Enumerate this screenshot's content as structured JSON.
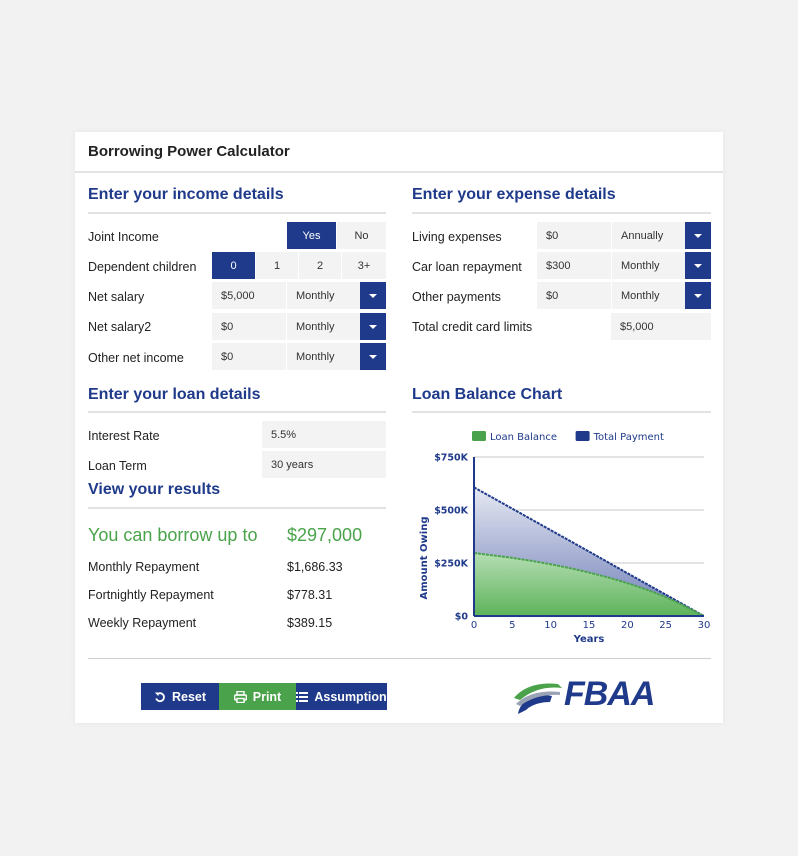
{
  "app": {
    "title": "Borrowing Power Calculator"
  },
  "income": {
    "title": "Enter your income details",
    "joint_income": {
      "label": "Joint Income",
      "options": [
        "Yes",
        "No"
      ],
      "selected": "Yes"
    },
    "dependent_children": {
      "label": "Dependent children",
      "options": [
        "0",
        "1",
        "2",
        "3+"
      ],
      "selected": "0"
    },
    "rows": [
      {
        "label": "Net salary",
        "value": "$5,000",
        "frequency": "Monthly"
      },
      {
        "label": "Net salary2",
        "value": "$0",
        "frequency": "Monthly"
      },
      {
        "label": "Other net income",
        "value": "$0",
        "frequency": "Monthly"
      }
    ]
  },
  "expenses": {
    "title": "Enter your expense details",
    "rows": [
      {
        "label": "Living expenses",
        "value": "$0",
        "frequency": "Annually"
      },
      {
        "label": "Car loan repayment",
        "value": "$300",
        "frequency": "Monthly"
      },
      {
        "label": "Other payments",
        "value": "$0",
        "frequency": "Monthly"
      }
    ],
    "credit_card": {
      "label": "Total credit card limits",
      "value": "$5,000"
    }
  },
  "loan": {
    "title": "Enter your loan details",
    "interest_rate": {
      "label": "Interest Rate",
      "value": "5.5%"
    },
    "loan_term": {
      "label": "Loan Term",
      "value": "30 years"
    }
  },
  "results": {
    "title": "View your results",
    "borrow_label": "You can borrow up to",
    "borrow_value": "$297,000",
    "rows": [
      {
        "label": "Monthly Repayment",
        "value": "$1,686.33"
      },
      {
        "label": "Fortnightly Repayment",
        "value": "$778.31"
      },
      {
        "label": "Weekly Repayment",
        "value": "$389.15"
      }
    ]
  },
  "chart_section": {
    "title": "Loan Balance Chart"
  },
  "buttons": {
    "reset": "Reset",
    "print": "Print",
    "assumption": "Assumption"
  },
  "logo": {
    "text": "FBAA"
  },
  "colors": {
    "primary": "#1f3a8a",
    "green": "#4aa34a",
    "field_bg": "#f3f3f3"
  },
  "chart_data": {
    "type": "area",
    "title": "Loan Balance Chart",
    "xlabel": "Years",
    "ylabel": "Amount Owing",
    "x": [
      0,
      5,
      10,
      15,
      20,
      25,
      30
    ],
    "x_ticks": [
      "0",
      "5",
      "10",
      "15",
      "20",
      "25",
      "30"
    ],
    "y_ticks": [
      "$0",
      "$250K",
      "$500K",
      "$750K"
    ],
    "y_tick_values": [
      0,
      250000,
      500000,
      750000
    ],
    "ylim": [
      0,
      750000
    ],
    "xlim": [
      0,
      30
    ],
    "grid": true,
    "legend_position": "top",
    "series": [
      {
        "name": "Loan Balance",
        "color": "#4aa34a",
        "values": [
          297000,
          274000,
          244000,
          205000,
          155000,
          89000,
          0
        ]
      },
      {
        "name": "Total Payment",
        "color": "#1f3a8a",
        "values": [
          607000,
          506000,
          405000,
          304000,
          202000,
          101000,
          0
        ]
      }
    ]
  }
}
